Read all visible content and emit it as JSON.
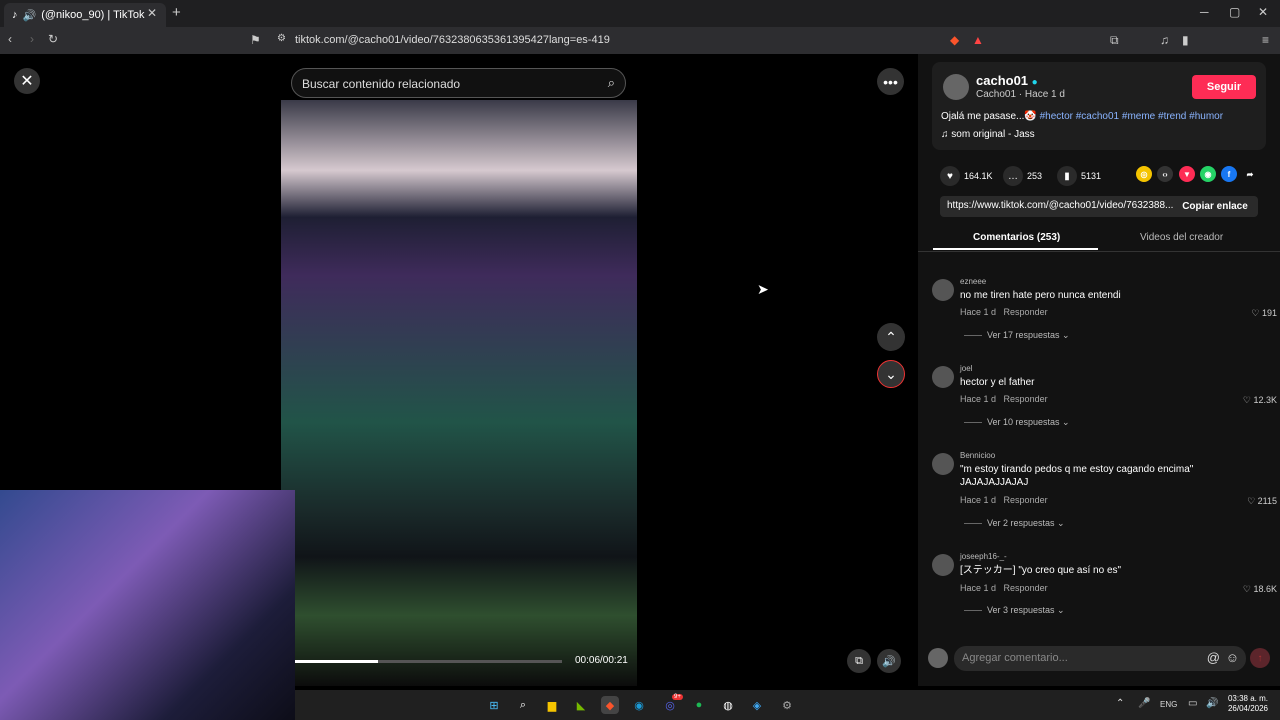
{
  "browser": {
    "tab_title": "(@nikoo_90) | TikTok",
    "url": "tiktok.com/@cacho01/video/7632380635361395427lang=es-419"
  },
  "player": {
    "search_placeholder": "Buscar contenido relacionado",
    "time": "00:06/00:21",
    "progress": 0.31
  },
  "creator": {
    "name": "cacho01",
    "sub": "Cacho01 · Hace 1 d",
    "follow_label": "Seguir",
    "description_prefix": "Ojalá me pasase...🤡",
    "hashtags": "#hector #cacho01 #meme #trend #humor",
    "music": "som original - Jass"
  },
  "stats": {
    "likes": "164.1K",
    "comments": "253",
    "saves": "5131"
  },
  "link": {
    "url": "https://www.tiktok.com/@cacho01/video/7632388...",
    "copy_label": "Copiar enlace"
  },
  "tabs": {
    "comments": "Comentarios (253)",
    "creator_videos": "Videos del creador"
  },
  "comments": [
    {
      "user": "ezneee",
      "text": "no me tiren hate pero nunca entendi",
      "time": "Hace 1 d",
      "reply": "Responder",
      "likes": "191",
      "replies": "Ver 17 respuestas"
    },
    {
      "user": "joel",
      "text": "hector y el father",
      "time": "Hace 1 d",
      "reply": "Responder",
      "likes": "12.3K",
      "replies": "Ver 10 respuestas"
    },
    {
      "user": "Bennicioo",
      "text": "\"m estoy tirando pedos q me estoy cagando encima\" JAJAJAJJAJAJ",
      "time": "Hace 1 d",
      "reply": "Responder",
      "likes": "2115",
      "replies": "Ver 2 respuestas"
    },
    {
      "user": "joseeph16-_-",
      "text": "[ステッカー] \"yo creo que así no es\"",
      "time": "Hace 1 d",
      "reply": "Responder",
      "likes": "18.6K",
      "replies": "Ver 3 respuestas"
    }
  ],
  "comment_input": {
    "placeholder": "Agregar comentario..."
  },
  "taskbar": {
    "lang": "ENG",
    "time": "03:38 a. m.",
    "date": "26/04/2026",
    "discord_badge": "9+"
  }
}
